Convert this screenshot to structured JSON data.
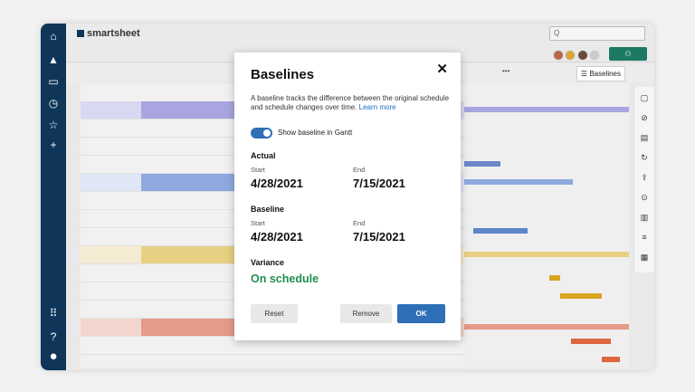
{
  "app": {
    "name": "smartsheet",
    "search_placeholder": "Q",
    "share_icon": "people-icon",
    "toolbar_more": "•••"
  },
  "toolbar": {
    "baselines_label": "Baselines"
  },
  "left_nav": [
    {
      "icon": "home-icon",
      "glyph": "⌂"
    },
    {
      "icon": "bell-icon",
      "glyph": "🔔"
    },
    {
      "icon": "folder-icon",
      "glyph": "▭"
    },
    {
      "icon": "clock-icon",
      "glyph": "◷"
    },
    {
      "icon": "star-icon",
      "glyph": "☆"
    },
    {
      "icon": "plus-icon",
      "glyph": "+"
    },
    {
      "icon": "apps-icon",
      "glyph": "⠿"
    },
    {
      "icon": "help-icon",
      "glyph": "?"
    },
    {
      "icon": "account-icon",
      "glyph": "●"
    }
  ],
  "right_panel_icons": [
    "comment-icon",
    "attachment-icon",
    "proofing-icon",
    "activity-icon",
    "publish-icon",
    "update-requests-icon",
    "forms-icon",
    "summary-icon",
    "report-icon"
  ],
  "modal": {
    "title": "Baselines",
    "description": "A baseline tracks the difference between the original schedule and schedule changes over time.",
    "learn_more": "Learn more",
    "toggle_label": "Show baseline in Gantt",
    "toggle_on": true,
    "actual": {
      "label": "Actual",
      "start_label": "Start",
      "start_value": "4/28/2021",
      "end_label": "End",
      "end_value": "7/15/2021"
    },
    "baseline": {
      "label": "Baseline",
      "start_label": "Start",
      "start_value": "4/28/2021",
      "end_label": "End",
      "end_value": "7/15/2021"
    },
    "variance": {
      "label": "Variance",
      "value": "On schedule"
    },
    "buttons": {
      "reset": "Reset",
      "remove": "Remove",
      "ok": "OK"
    }
  },
  "colors": {
    "nav": "#0f3659",
    "accent": "#2e6fb7",
    "success": "#1e8e4e",
    "row_purple": "#a9a5e0",
    "row_blue": "#8ea9df",
    "row_yellow": "#e8d083",
    "row_red": "#e59b88"
  }
}
